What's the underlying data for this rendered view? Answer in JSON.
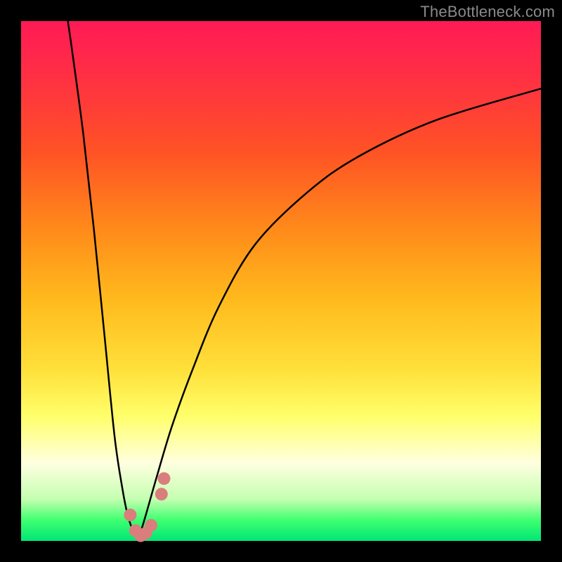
{
  "watermark": {
    "text": "TheBottleneck.com"
  },
  "chart_data": {
    "type": "line",
    "title": "",
    "xlabel": "",
    "ylabel": "",
    "xlim": [
      0,
      100
    ],
    "ylim": [
      0,
      100
    ],
    "background_gradient": {
      "orientation": "vertical",
      "stops": [
        {
          "pos": 0,
          "color": "#ff1a55"
        },
        {
          "pos": 0.4,
          "color": "#ff8a1a"
        },
        {
          "pos": 0.7,
          "color": "#ffe03a"
        },
        {
          "pos": 0.85,
          "color": "#ffffe0"
        },
        {
          "pos": 1.0,
          "color": "#00e676"
        }
      ]
    },
    "series": [
      {
        "name": "left-branch",
        "stroke": "#000000",
        "x": [
          9,
          10,
          12,
          14,
          16,
          18,
          19.5,
          20.5,
          21.5,
          22.5
        ],
        "y": [
          100,
          93,
          78,
          60,
          40,
          20,
          10,
          5,
          2,
          0
        ]
      },
      {
        "name": "right-branch",
        "stroke": "#000000",
        "x": [
          22.5,
          24,
          26,
          29,
          33,
          38,
          45,
          55,
          65,
          80,
          100
        ],
        "y": [
          0,
          5,
          12,
          22,
          33,
          45,
          57,
          67,
          74,
          81,
          87
        ]
      }
    ],
    "markers": [
      {
        "name": "cluster-a",
        "color": "#da7d7d",
        "radius": 9,
        "points": [
          [
            21,
            5
          ],
          [
            22,
            2
          ],
          [
            23,
            1
          ],
          [
            24,
            1.5
          ],
          [
            25,
            3
          ]
        ]
      },
      {
        "name": "cluster-b",
        "color": "#da7d7d",
        "radius": 9,
        "points": [
          [
            27,
            9
          ],
          [
            27.5,
            12
          ]
        ]
      }
    ]
  }
}
